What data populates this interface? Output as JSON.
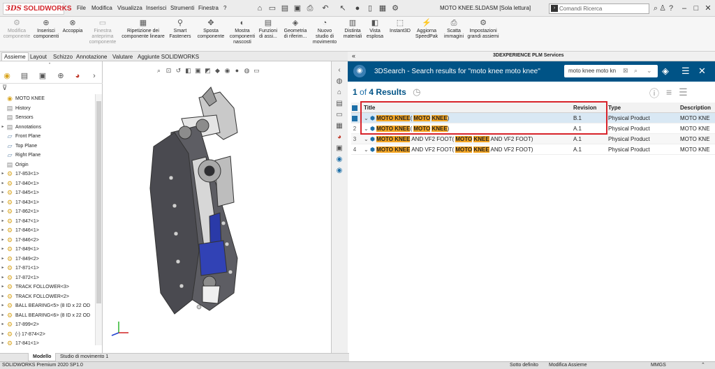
{
  "app": {
    "brand": "SOLIDWORKS",
    "brand_mark": "3DS",
    "doc_title": "MOTO KNEE.SLDASM [Sola lettura]"
  },
  "menu": [
    "File",
    "Modifica",
    "Visualizza",
    "Inserisci",
    "Strumenti",
    "Finestra",
    "?"
  ],
  "search": {
    "placeholder": "Comandi Ricerca"
  },
  "toolbar": [
    {
      "label": "Modifica componente",
      "icon": "edit-component-icon",
      "enabled": false
    },
    {
      "label": "Inserisci componenti",
      "icon": "insert-components-icon",
      "enabled": true
    },
    {
      "label": "Accoppia",
      "icon": "mate-icon",
      "enabled": true
    },
    {
      "label": "Finestra anteprima componente",
      "icon": "preview-window-icon",
      "enabled": false
    },
    {
      "label": "Ripetizione dei componente lineare",
      "icon": "linear-pattern-icon",
      "enabled": true
    },
    {
      "label": "Smart Fasteners",
      "icon": "smart-fasteners-icon",
      "enabled": true
    },
    {
      "label": "Sposta componente",
      "icon": "move-component-icon",
      "enabled": true
    },
    {
      "label": "Mostra componenti nascosti",
      "icon": "show-hidden-icon",
      "enabled": true
    },
    {
      "label": "Funzioni di assi...",
      "icon": "assembly-features-icon",
      "enabled": true
    },
    {
      "label": "Geometria di riferim...",
      "icon": "reference-geometry-icon",
      "enabled": true
    },
    {
      "label": "Nuovo studio di movimento",
      "icon": "motion-study-icon",
      "enabled": true
    },
    {
      "label": "Distinta materiali",
      "icon": "bom-icon",
      "enabled": true
    },
    {
      "label": "Vista esplosa",
      "icon": "exploded-view-icon",
      "enabled": true
    },
    {
      "label": "Instant3D",
      "icon": "instant3d-icon",
      "enabled": true
    },
    {
      "label": "Aggiorna SpeedPak",
      "icon": "speedpak-icon",
      "enabled": true
    },
    {
      "label": "Scatta immagini",
      "icon": "camera-icon",
      "enabled": true
    },
    {
      "label": "Impostazioni grandi assiemi",
      "icon": "large-assembly-icon",
      "enabled": true
    }
  ],
  "tabs": [
    "Assieme",
    "Layout",
    "Schizzo",
    "Annotazione",
    "Valutare",
    "Aggiunte SOLIDWORKS"
  ],
  "tree": [
    {
      "label": "MOTO KNEE",
      "kind": "root",
      "expand": false
    },
    {
      "label": "History",
      "kind": "misc",
      "expand": false
    },
    {
      "label": "Sensors",
      "kind": "misc",
      "expand": false
    },
    {
      "label": "Annotations",
      "kind": "misc",
      "expand": true
    },
    {
      "label": "Front Plane",
      "kind": "plane",
      "expand": false
    },
    {
      "label": "Top Plane",
      "kind": "plane",
      "expand": false
    },
    {
      "label": "Right Plane",
      "kind": "plane",
      "expand": false
    },
    {
      "label": "Origin",
      "kind": "misc",
      "expand": false
    },
    {
      "label": "17-853<1>",
      "kind": "part",
      "expand": true
    },
    {
      "label": "17-840<1>",
      "kind": "part",
      "expand": true
    },
    {
      "label": "17-845<1>",
      "kind": "part",
      "expand": true
    },
    {
      "label": "17-843<1>",
      "kind": "part",
      "expand": true
    },
    {
      "label": "17-862<1>",
      "kind": "part",
      "expand": true
    },
    {
      "label": "17-847<1>",
      "kind": "part",
      "expand": true
    },
    {
      "label": "17-846<1>",
      "kind": "part",
      "expand": true
    },
    {
      "label": "17-846<2>",
      "kind": "part",
      "expand": true
    },
    {
      "label": "17-849<1>",
      "kind": "part",
      "expand": true
    },
    {
      "label": "17-849<2>",
      "kind": "part",
      "expand": true
    },
    {
      "label": "17-871<1>",
      "kind": "part",
      "expand": true
    },
    {
      "label": "17-872<1>",
      "kind": "part",
      "expand": true
    },
    {
      "label": "TRACK FOLLOWER<3>",
      "kind": "part",
      "expand": true
    },
    {
      "label": "TRACK FOLLOWER<2>",
      "kind": "part",
      "expand": true
    },
    {
      "label": "BALL BEARING<5> (8 ID x 22 OD",
      "kind": "part",
      "expand": true
    },
    {
      "label": "BALL BEARING<6> (8 ID x 22 OD",
      "kind": "part",
      "expand": true
    },
    {
      "label": "17-899<2>",
      "kind": "part",
      "expand": true
    },
    {
      "label": "(-) 17-874<2>",
      "kind": "part",
      "expand": true
    },
    {
      "label": "17-841<1>",
      "kind": "part",
      "expand": true
    }
  ],
  "bottom_tabs": [
    "Modello",
    "Studio di movimento 1"
  ],
  "status": {
    "left": "SOLIDWORKS Premium 2020 SP1.0",
    "center": "Sotto definito",
    "mode": "Modifica Assieme",
    "units": "MMGS"
  },
  "panel": {
    "header": "3DEXPERIENCE PLM Services",
    "title": "3DSearch - Search results for \"moto knee moto knee\"",
    "search_value": "moto knee moto kn",
    "results_prefix": "1",
    "results_of": "of",
    "results_count": "4",
    "results_label": "Results",
    "columns": [
      "Title",
      "Revision",
      "Type",
      "Description"
    ],
    "rows": [
      {
        "num": "1",
        "checked": true,
        "title": [
          [
            "MOTO KNEE",
            true
          ],
          [
            "( ",
            false
          ],
          [
            "MOTO",
            true
          ],
          [
            " ",
            false
          ],
          [
            "KNEE",
            true
          ],
          [
            ")",
            false
          ]
        ],
        "revision": "B.1",
        "type": "Physical Product",
        "description": "MOTO KNE"
      },
      {
        "num": "2",
        "checked": false,
        "title": [
          [
            "MOTO KNEE",
            true
          ],
          [
            "( ",
            false
          ],
          [
            "MOTO",
            true
          ],
          [
            " ",
            false
          ],
          [
            "KNEE",
            true
          ],
          [
            ")",
            false
          ]
        ],
        "revision": "A.1",
        "type": "Physical Product",
        "description": "MOTO KNE"
      },
      {
        "num": "3",
        "checked": false,
        "title": [
          [
            "MOTO KNEE",
            true
          ],
          [
            " AND VF2 FOOT( ",
            false
          ],
          [
            "MOTO",
            true
          ],
          [
            " ",
            false
          ],
          [
            "KNEE",
            true
          ],
          [
            " AND VF2 FOOT)",
            false
          ]
        ],
        "revision": "A.1",
        "type": "Physical Product",
        "description": "MOTO KNE"
      },
      {
        "num": "4",
        "checked": false,
        "title": [
          [
            "MOTO KNEE",
            true
          ],
          [
            " AND VF2 FOOT( ",
            false
          ],
          [
            "MOTO",
            true
          ],
          [
            " ",
            false
          ],
          [
            "KNEE",
            true
          ],
          [
            " AND VF2 FOOT)",
            false
          ]
        ],
        "revision": "A.1",
        "type": "Physical Product",
        "description": "MOTO KNE"
      }
    ]
  },
  "colors": {
    "accent_blue": "#005386",
    "highlight": "#f5a623",
    "red_box": "#d8232a",
    "brand_red": "#d2262c"
  }
}
